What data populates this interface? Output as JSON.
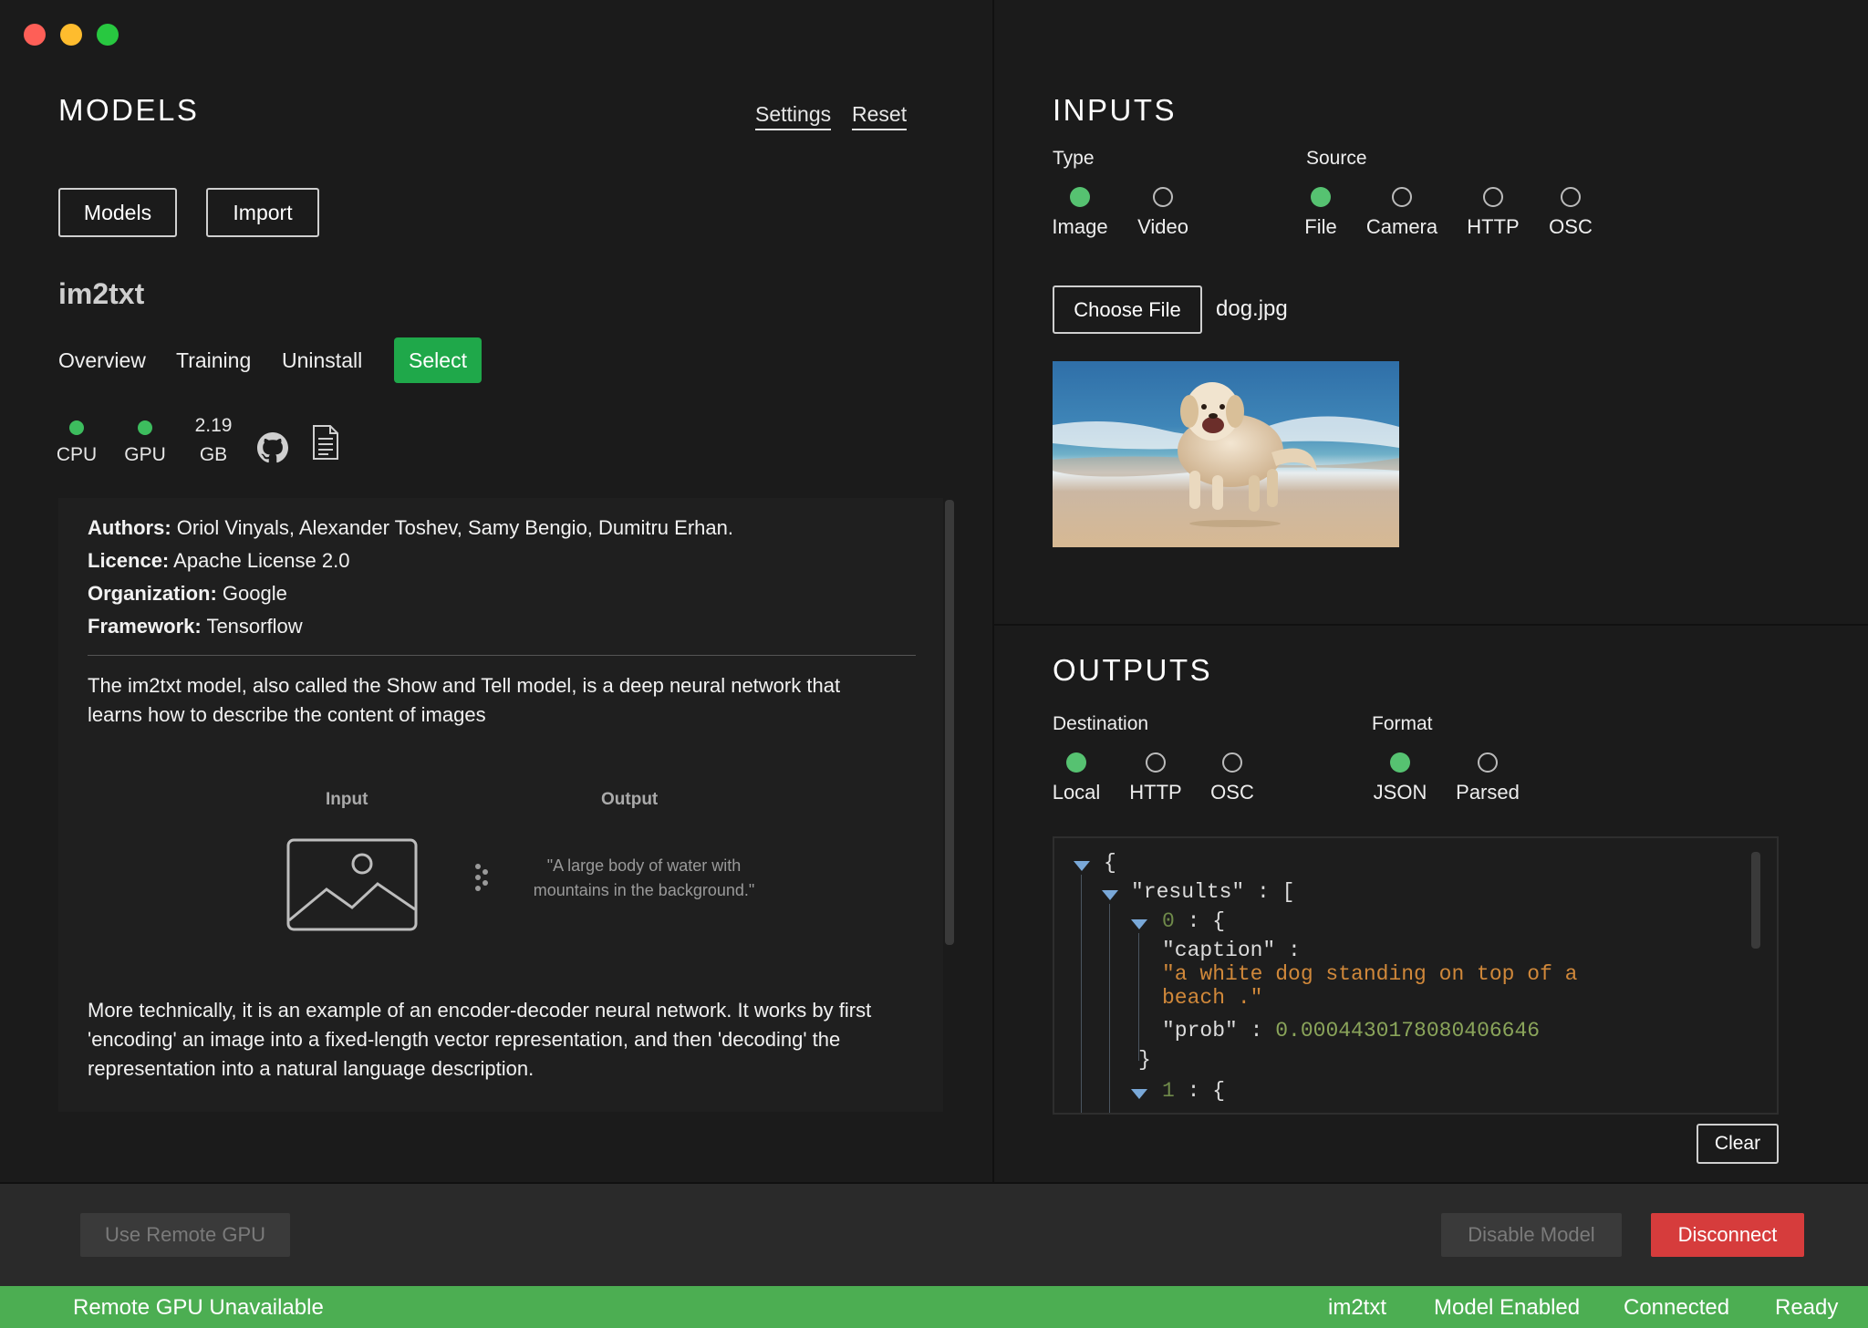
{
  "models": {
    "heading": "MODELS",
    "settings_link": "Settings",
    "reset_link": "Reset",
    "models_button": "Models",
    "import_button": "Import",
    "model_name": "im2txt",
    "tabs": [
      "Overview",
      "Training",
      "Uninstall"
    ],
    "select_button": "Select",
    "stats": {
      "cpu_label": "CPU",
      "gpu_label": "GPU",
      "size_value": "2.19",
      "size_unit": "GB"
    },
    "info": {
      "authors_label": "Authors:",
      "authors": "Oriol Vinyals, Alexander Toshev, Samy Bengio, Dumitru Erhan.",
      "licence_label": "Licence:",
      "licence": "Apache License 2.0",
      "organization_label": "Organization:",
      "organization": "Google",
      "framework_label": "Framework:",
      "framework": "Tensorflow",
      "description_line1": "The im2txt model, also called the Show and Tell model, is a deep neural network that",
      "description_line2": "learns how to describe the content of images",
      "diagram_input_label": "Input",
      "diagram_output_label": "Output",
      "diagram_quote": "\"A large body of water with mountains in the background.\"",
      "technical_line1": "More technically, it is an example of an encoder-decoder neural network. It works by first",
      "technical_line2": "'encoding' an image into a fixed-length vector representation, and then 'decoding' the",
      "technical_line3": "representation into a natural language description."
    }
  },
  "inputs": {
    "heading": "INPUTS",
    "type_label": "Type",
    "type_options": [
      "Image",
      "Video"
    ],
    "type_selected": "Image",
    "source_label": "Source",
    "source_options": [
      "File",
      "Camera",
      "HTTP",
      "OSC"
    ],
    "source_selected": "File",
    "choose_file_button": "Choose File",
    "file_name": "dog.jpg"
  },
  "outputs": {
    "heading": "OUTPUTS",
    "destination_label": "Destination",
    "destination_options": [
      "Local",
      "HTTP",
      "OSC"
    ],
    "destination_selected": "Local",
    "format_label": "Format",
    "format_options": [
      "JSON",
      "Parsed"
    ],
    "format_selected": "JSON",
    "json": {
      "open_brace": "{",
      "results_key": "\"results\"",
      "results_sep": " : [",
      "index0": "0",
      "index0_sep": " : {",
      "caption_key": "\"caption\" :",
      "caption_value_line1": "\"a white dog standing on top of a",
      "caption_value_line2": "beach .\"",
      "prob_key": "\"prob\" : ",
      "prob_value": "0.0004430178080406646",
      "close_brace": "}",
      "index1": "1",
      "index1_sep": " : {"
    },
    "clear_button": "Clear"
  },
  "footer": {
    "use_remote_gpu_button": "Use Remote GPU",
    "disable_model_button": "Disable Model",
    "disconnect_button": "Disconnect"
  },
  "status_bar": {
    "remote_gpu": "Remote GPU Unavailable",
    "model": "im2txt",
    "model_state": "Model Enabled",
    "connection": "Connected",
    "ready": "Ready"
  },
  "colors": {
    "accent_green": "#1fa84a",
    "radio_green": "#56c271",
    "status_bar_green": "#4cae52",
    "disconnect_red": "#d63c3c",
    "json_string": "#d0883a",
    "json_number": "#8aa45a"
  }
}
